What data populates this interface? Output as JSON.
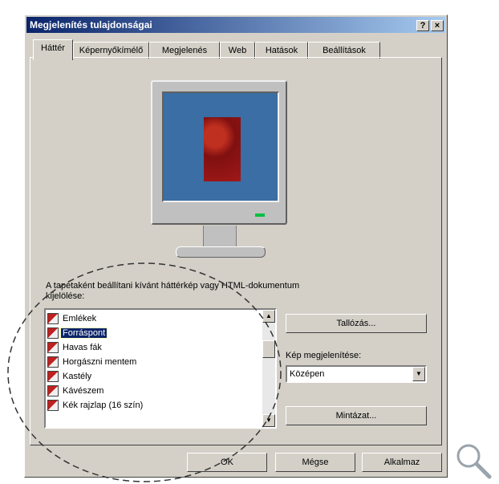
{
  "window": {
    "title": "Megjelenítés tulajdonságai",
    "help": "?",
    "close": "×"
  },
  "tabs": [
    "Háttér",
    "Képernyőkímélő",
    "Megjelenés",
    "Web",
    "Hatások",
    "Beállítások"
  ],
  "wallpaper": {
    "label": "A tapétaként beállítani kívánt háttérkép vagy HTML-dokumentum kijelölése:",
    "items": [
      "Emlékek",
      "Forráspont",
      "Havas fák",
      "Horgászni mentem",
      "Kastély",
      "Kávészem",
      "Kék rajzlap (16 szín)"
    ],
    "selected": "Forráspont",
    "browse_button": "Tallózás...",
    "display_label": "Kép megjelenítése:",
    "display_value": "Középen",
    "pattern_button": "Mintázat..."
  },
  "footer": {
    "ok": "OK",
    "cancel": "Mégse",
    "apply": "Alkalmaz"
  },
  "colors": {
    "titlebar": "#0a246a",
    "desktop": "#3a6ea5",
    "selection": "#0a246a"
  },
  "icons": {
    "magnifier": "zoom-magnifier-icon"
  }
}
